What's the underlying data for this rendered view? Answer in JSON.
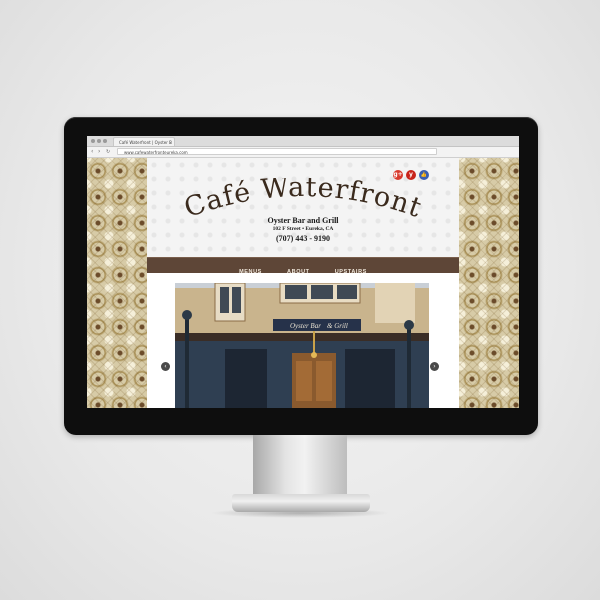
{
  "browser": {
    "tab_title": "Café Waterfront | Oyster B",
    "tab_close": "×",
    "url": "www.cafewaterfronteureka.com",
    "back": "‹",
    "forward": "›",
    "reload": "↻"
  },
  "site": {
    "logo": "Café Waterfront",
    "tagline": "Oyster Bar and Grill",
    "address": "102 F Street • Eureka, CA",
    "phone": "(707) 443 - 9190",
    "social": [
      "g+",
      "y",
      "👍"
    ],
    "nav": [
      "MENUS",
      "ABOUT",
      "UPSTAIRS"
    ],
    "slider_prev": "‹",
    "slider_next": "›",
    "photo": {
      "sign_left": "Oyster Bar",
      "sign_right": "& Grill"
    }
  },
  "colors": {
    "nav_bg": "#5e4637",
    "logo": "#3a2a1d",
    "pattern": "#d7cba7",
    "social_red": "#d83a2d"
  }
}
